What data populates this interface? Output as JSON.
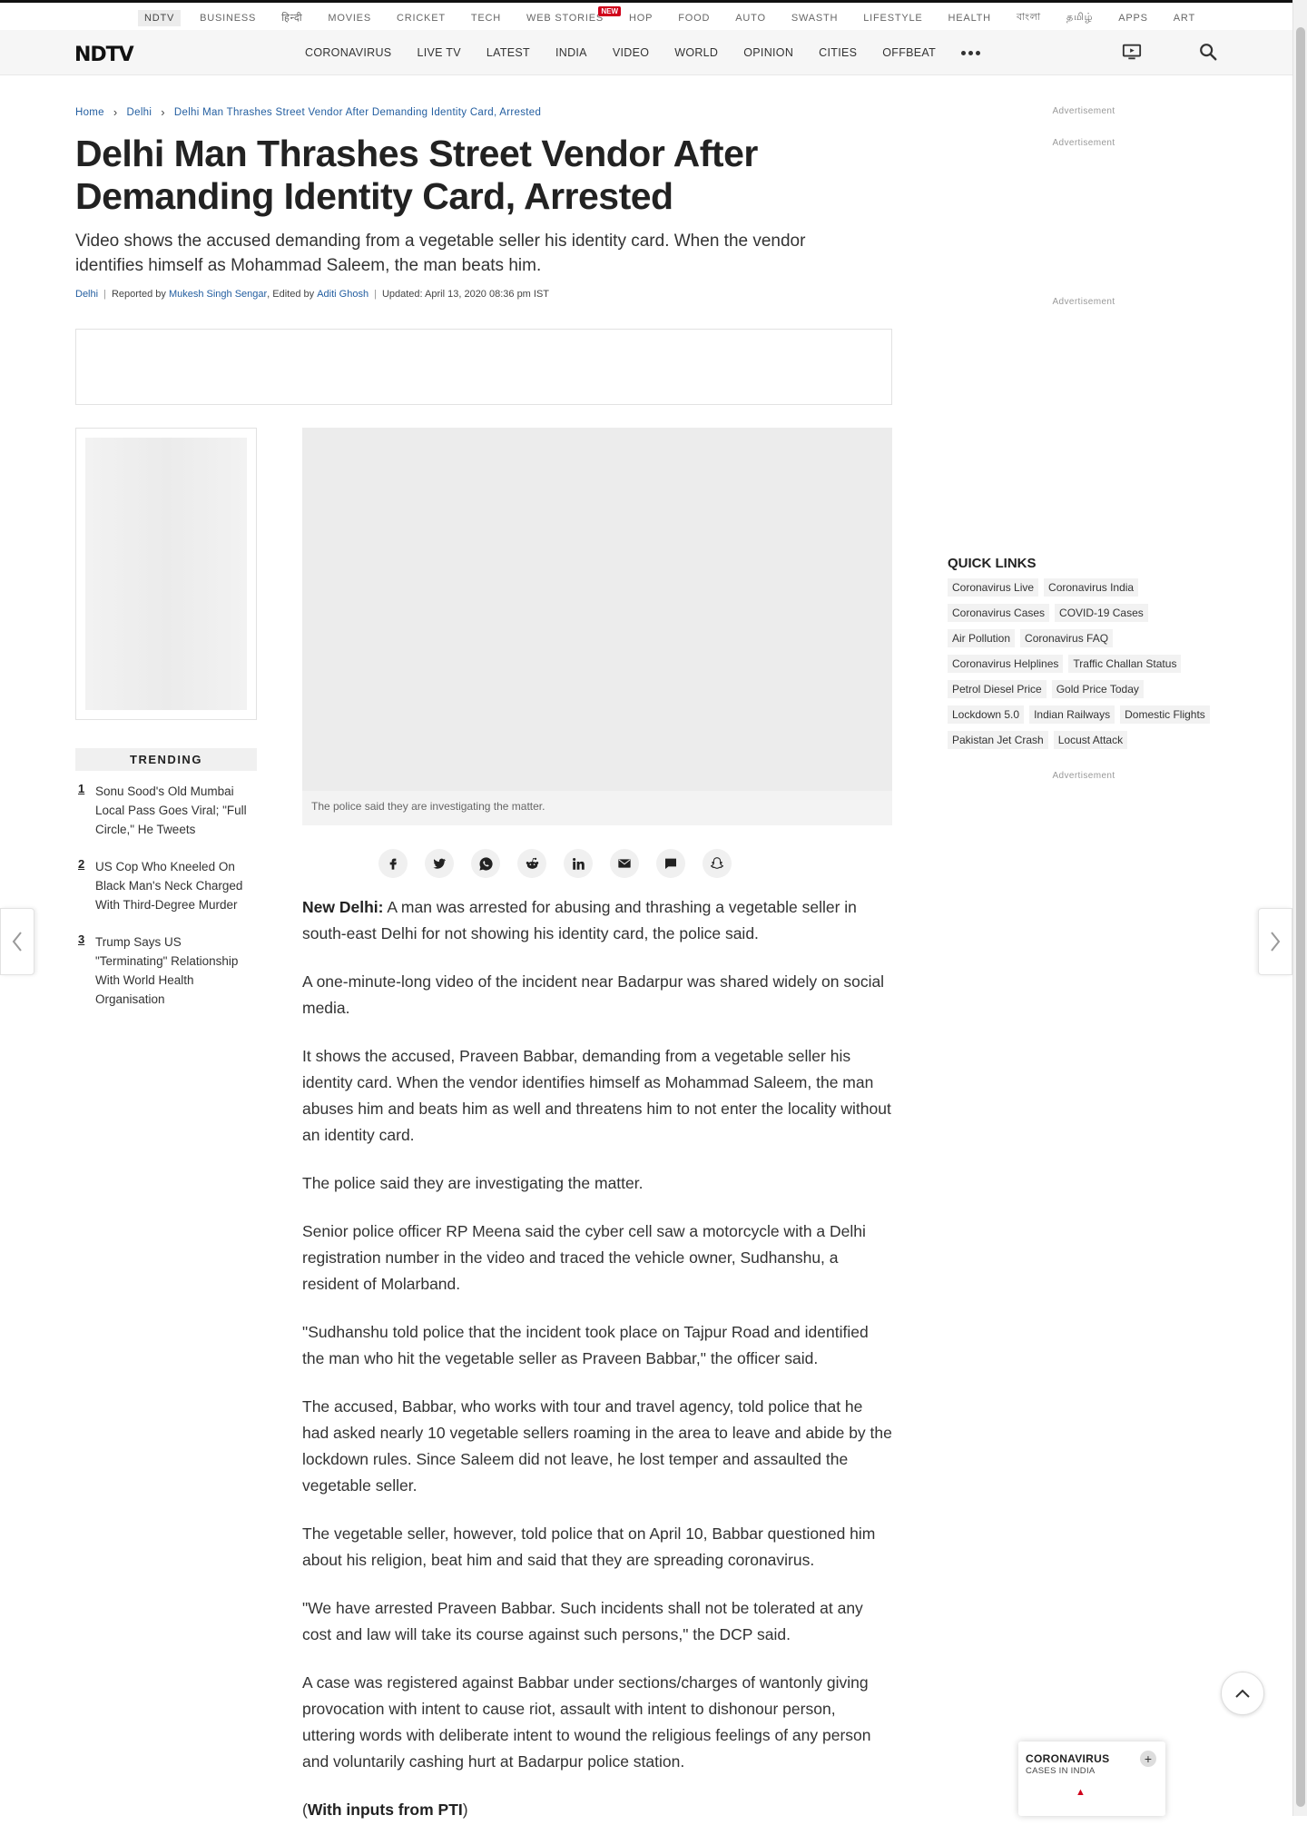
{
  "topbar": {
    "items": [
      "NDTV",
      "BUSINESS",
      "हिन्दी",
      "MOVIES",
      "CRICKET",
      "TECH",
      "WEB STORIES",
      "HOP",
      "FOOD",
      "AUTO",
      "SWASTH",
      "LIFESTYLE",
      "HEALTH",
      "বাংলা",
      "தமிழ்",
      "APPS",
      "ART"
    ],
    "new_badge": "NEW"
  },
  "nav": {
    "logo": "NDTV",
    "items": [
      "CORONAVIRUS",
      "LIVE TV",
      "LATEST",
      "INDIA",
      "VIDEO",
      "WORLD",
      "OPINION",
      "CITIES",
      "OFFBEAT"
    ]
  },
  "breadcrumb": {
    "home": "Home",
    "section": "Delhi",
    "current": "Delhi Man Thrashes Street Vendor After Demanding Identity Card, Arrested"
  },
  "article": {
    "title": "Delhi Man Thrashes Street Vendor After Demanding Identity Card, Arrested",
    "synopsis": "Video shows the accused demanding from a vegetable seller his identity card. When the vendor identifies himself as Mohammad Saleem, the man beats him.",
    "byline": {
      "category": "Delhi",
      "reported_prefix": "Reported by",
      "reporter": "Mukesh Singh Sengar",
      "edited_prefix": ", Edited by",
      "editor": "Aditi Ghosh",
      "updated": "Updated: April 13, 2020 08:36 pm IST"
    },
    "video_caption": "The police said they are investigating the matter.",
    "lead_place": "New Delhi:",
    "lead_text": " A man was arrested for abusing and thrashing a vegetable seller in south-east Delhi for not showing his identity card, the police said.",
    "paragraphs": [
      "A one-minute-long video of the incident near Badarpur was shared widely on social media.",
      "It shows the accused, Praveen Babbar, demanding from a vegetable seller his identity card. When the vendor identifies himself as Mohammad Saleem, the man abuses him and beats him as well and threatens him to not enter the locality without an identity card.",
      "The police said they are investigating the matter.",
      "Senior police officer RP Meena said the cyber cell saw a motorcycle with a Delhi registration number in the video and traced the vehicle owner, Sudhanshu, a resident of Molarband.",
      "\"Sudhanshu told police that the incident took place on Tajpur Road and identified the man who hit the vegetable seller as Praveen Babbar,\" the officer said.",
      "The accused, Babbar, who works with tour and travel agency, told police that he had asked nearly 10 vegetable sellers roaming in the area to leave and abide by the lockdown rules. Since Saleem did not leave, he lost temper and assaulted the vegetable seller.",
      "The vegetable seller, however, told police that on April 10, Babbar questioned him about his religion, beat him and said that they are spreading coronavirus.",
      "\"We have arrested Praveen Babbar. Such incidents shall not be tolerated at any cost and law will take its course against such persons,\" the DCP said.",
      "A case was registered against Babbar under sections/charges of wantonly giving provocation with intent to cause riot, assault with intent to dishonour person, uttering words with deliberate intent to wound the religious feelings of any person and voluntarily cashing hurt at Badarpur police station."
    ],
    "credit_open": "(",
    "credit": "With inputs from PTI",
    "credit_close": ")"
  },
  "trending": {
    "heading": "TRENDING",
    "items": [
      {
        "num": "1",
        "text": "Sonu Sood's Old Mumbai Local Pass Goes Viral; \"Full Circle,\" He Tweets"
      },
      {
        "num": "2",
        "text": "US Cop Who Kneeled On Black Man's Neck Charged With Third-Degree Murder"
      },
      {
        "num": "3",
        "text": "Trump Says US \"Terminating\" Relationship With World Health Organisation"
      }
    ]
  },
  "sidebar": {
    "ad_label": "Advertisement"
  },
  "quick_links": {
    "heading": "QUICK LINKS",
    "items": [
      "Coronavirus Live",
      "Coronavirus India",
      "Coronavirus Cases",
      "COVID-19 Cases",
      "Air Pollution",
      "Coronavirus FAQ",
      "Coronavirus Helplines",
      "Traffic Challan Status",
      "Petrol Diesel Price",
      "Gold Price Today",
      "Lockdown 5.0",
      "Indian Railways",
      "Domestic Flights",
      "Pakistan Jet Crash",
      "Locust Attack"
    ]
  },
  "covid_widget": {
    "title": "CORONAVIRUS",
    "subtitle": "CASES IN INDIA",
    "expand": "+",
    "arrow": "▲"
  },
  "icons": [
    "facebook-icon",
    "twitter-icon",
    "whatsapp-icon",
    "reddit-icon",
    "linkedin-icon",
    "email-icon",
    "comment-icon",
    "snapchat-icon",
    "tv-icon",
    "search-icon",
    "chevron-left-icon",
    "chevron-right-icon",
    "chevron-up-icon"
  ],
  "colors": {
    "link": "#235ea0",
    "badge": "#d0021b",
    "text": "#333333"
  }
}
